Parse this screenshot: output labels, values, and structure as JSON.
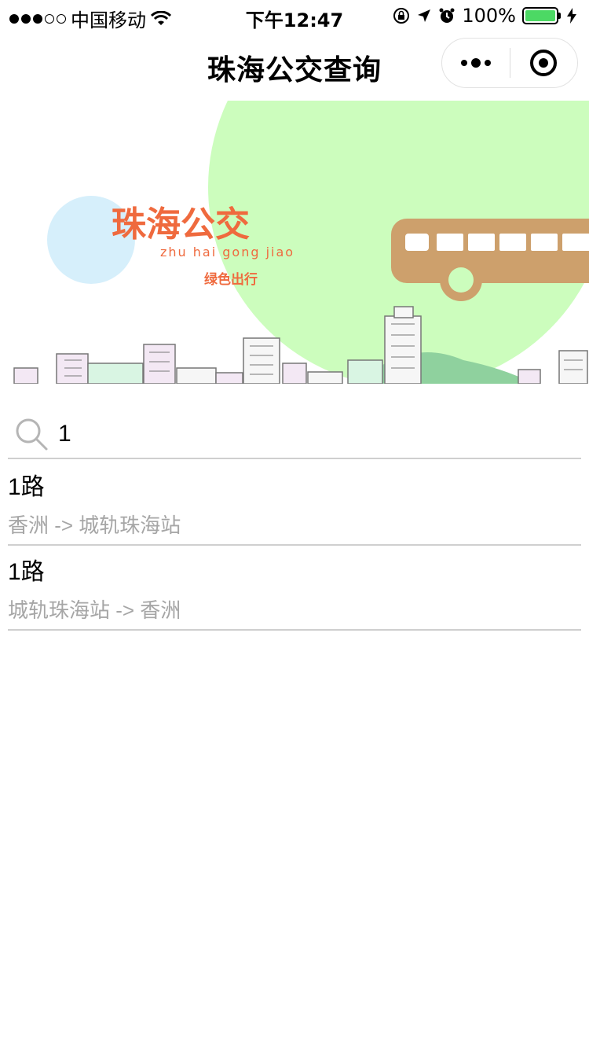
{
  "status_bar": {
    "carrier": "中国移动",
    "time": "下午12:47",
    "battery_percent": "100%",
    "battery_level": 1.0
  },
  "nav": {
    "title": "珠海公交查询"
  },
  "banner": {
    "logo_main": "珠海公交",
    "logo_pinyin": "zhu hai gong jiao",
    "slogan": "绿色出行",
    "colors": {
      "logo": "#ef6a3e",
      "green_circle": "#ccfdbd",
      "blue_circle": "#d6effb",
      "bus": "#cda06c"
    }
  },
  "search": {
    "value": "1",
    "icon": "search-icon"
  },
  "results": [
    {
      "name": "1路",
      "direction": "香洲 -> 城轨珠海站"
    },
    {
      "name": "1路",
      "direction": "城轨珠海站 -> 香洲"
    }
  ]
}
